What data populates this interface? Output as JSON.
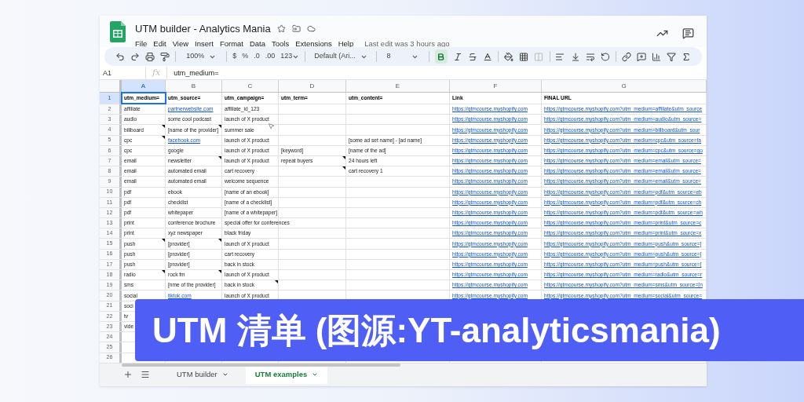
{
  "window": {
    "title": "UTM builder - Analytics Mania",
    "last_edit": "Last edit was 3 hours ago"
  },
  "menu": [
    "File",
    "Edit",
    "View",
    "Insert",
    "Format",
    "Data",
    "Tools",
    "Extensions",
    "Help"
  ],
  "toolbar": {
    "zoom": "100%",
    "currency": "$",
    "percent": "%",
    "decrease_decimals": ".0",
    "increase_decimals": ".00",
    "number_format": "123",
    "font": "Default (Ari...",
    "font_size": "8",
    "bold_on": true
  },
  "formula_bar": {
    "name_box": "A1",
    "fx": "fx",
    "formula": "utm_medium="
  },
  "columns": [
    {
      "label": "A",
      "selected": true
    },
    {
      "label": "B",
      "selected": false
    },
    {
      "label": "C",
      "selected": false
    },
    {
      "label": "D",
      "selected": false
    },
    {
      "label": "E",
      "selected": false
    },
    {
      "label": "F",
      "selected": false
    },
    {
      "label": "G",
      "selected": false
    }
  ],
  "rows": [
    {
      "number": "1",
      "kind": "header",
      "selected": true,
      "cells": [
        {
          "text": "utm_medium=",
          "link": false,
          "note": false
        },
        {
          "text": "utm_source=",
          "link": false,
          "note": false
        },
        {
          "text": "utm_campaign=",
          "link": false,
          "note": false
        },
        {
          "text": "utm_term=",
          "link": false,
          "note": false
        },
        {
          "text": "utm_content=",
          "link": false,
          "note": false
        },
        {
          "text": "Link",
          "link": false,
          "note": false
        },
        {
          "text": "FINAL URL",
          "link": false,
          "note": false
        }
      ]
    },
    {
      "number": "2",
      "kind": "data",
      "selected": false,
      "cells": [
        {
          "text": "affiliate",
          "link": false,
          "note": false
        },
        {
          "text": "partnerwebsite.com",
          "link": true,
          "note": false
        },
        {
          "text": "affiliate_id_123",
          "link": false,
          "note": false
        },
        {
          "note": false
        },
        {
          "note": false
        },
        {
          "text": "https://gtmcourse.myshopify.com",
          "link": true,
          "note": false
        },
        {
          "text": "https://gtmcourse.myshopify.com?utm_medium=affiliate&utm_source",
          "link": true,
          "note": false
        }
      ]
    },
    {
      "number": "3",
      "kind": "data",
      "selected": false,
      "cells": [
        {
          "text": "audio",
          "link": false,
          "note": false
        },
        {
          "text": "some cool podcast",
          "link": false,
          "note": false
        },
        {
          "text": "launch of X product",
          "link": false,
          "note": false
        },
        {
          "note": false
        },
        {
          "note": false
        },
        {
          "text": "https://gtmcourse.myshopify.com",
          "link": true,
          "note": false
        },
        {
          "text": "https://gtmcourse.myshopify.com?utm_medium=audio&utm_source=",
          "link": true,
          "note": false
        }
      ]
    },
    {
      "number": "4",
      "kind": "data",
      "selected": false,
      "cells": [
        {
          "text": "billboard",
          "link": false,
          "note": true
        },
        {
          "text": "[name of the provider]",
          "link": false,
          "note": true
        },
        {
          "text": "summer sale",
          "link": false,
          "note": false
        },
        {
          "note": false
        },
        {
          "note": false
        },
        {
          "text": "https://gtmcourse.myshopify.com",
          "link": true,
          "note": false
        },
        {
          "text": "https://gtmcourse.myshopify.com?utm_medium=billboard&utm_sour",
          "link": true,
          "note": false
        }
      ]
    },
    {
      "number": "5",
      "kind": "data",
      "selected": false,
      "cells": [
        {
          "text": "cpc",
          "link": false,
          "note": true
        },
        {
          "text": "facebook.com",
          "link": true,
          "note": false
        },
        {
          "text": "launch of X product",
          "link": false,
          "note": false
        },
        {
          "note": false
        },
        {
          "text": "[some ad set name] - [ad name]",
          "link": false,
          "note": false
        },
        {
          "text": "https://gtmcourse.myshopify.com",
          "link": true,
          "note": false
        },
        {
          "text": "https://gtmcourse.myshopify.com?utm_medium=cpc&utm_source=fa",
          "link": true,
          "note": false
        }
      ]
    },
    {
      "number": "6",
      "kind": "data",
      "selected": false,
      "cells": [
        {
          "text": "cpc",
          "link": false,
          "note": false
        },
        {
          "text": "google",
          "link": false,
          "note": false
        },
        {
          "text": "launch of X product",
          "link": false,
          "note": false
        },
        {
          "text": "[keyword]",
          "link": false,
          "note": false
        },
        {
          "text": "[name of the ad]",
          "link": false,
          "note": false
        },
        {
          "text": "https://gtmcourse.myshopify.com",
          "link": true,
          "note": false
        },
        {
          "text": "https://gtmcourse.myshopify.com?utm_medium=cpc&utm_source=go",
          "link": true,
          "note": false
        }
      ]
    },
    {
      "number": "7",
      "kind": "data",
      "selected": false,
      "cells": [
        {
          "text": "email",
          "link": false,
          "note": false
        },
        {
          "text": "newsletter",
          "link": false,
          "note": true
        },
        {
          "text": "launch of X product",
          "link": false,
          "note": false
        },
        {
          "text": "repeat buyers",
          "link": false,
          "note": true
        },
        {
          "text": "24 hours left",
          "link": false,
          "note": false
        },
        {
          "text": "https://gtmcourse.myshopify.com",
          "link": true,
          "note": false
        },
        {
          "text": "https://gtmcourse.myshopify.com?utm_medium=email&utm_source=",
          "link": true,
          "note": false
        }
      ]
    },
    {
      "number": "8",
      "kind": "data",
      "selected": false,
      "cells": [
        {
          "text": "email",
          "link": false,
          "note": false
        },
        {
          "text": "automated email",
          "link": false,
          "note": false
        },
        {
          "text": "cart recovery",
          "link": false,
          "note": false
        },
        {
          "note": true
        },
        {
          "text": "cart recovery 1",
          "link": false,
          "note": false
        },
        {
          "text": "https://gtmcourse.myshopify.com",
          "link": true,
          "note": false
        },
        {
          "text": "https://gtmcourse.myshopify.com?utm_medium=email&utm_source=",
          "link": true,
          "note": false
        }
      ]
    },
    {
      "number": "9",
      "kind": "data",
      "selected": false,
      "cells": [
        {
          "text": "email",
          "link": false,
          "note": false
        },
        {
          "text": "automated email",
          "link": false,
          "note": false
        },
        {
          "text": "welcome sequence",
          "link": false,
          "note": false
        },
        {
          "note": false
        },
        {
          "note": false
        },
        {
          "text": "https://gtmcourse.myshopify.com",
          "link": true,
          "note": false
        },
        {
          "text": "https://gtmcourse.myshopify.com?utm_medium=email&utm_source=",
          "link": true,
          "note": false
        }
      ]
    },
    {
      "number": "10",
      "kind": "data",
      "selected": false,
      "cells": [
        {
          "text": "pdf",
          "link": false,
          "note": false
        },
        {
          "text": "ebook",
          "link": false,
          "note": false
        },
        {
          "text": "[name of an ebook]",
          "link": false,
          "note": false
        },
        {
          "note": false
        },
        {
          "note": false
        },
        {
          "text": "https://gtmcourse.myshopify.com",
          "link": true,
          "note": false
        },
        {
          "text": "https://gtmcourse.myshopify.com?utm_medium=pdf&utm_source=eb",
          "link": true,
          "note": false
        }
      ]
    },
    {
      "number": "11",
      "kind": "data",
      "selected": false,
      "cells": [
        {
          "text": "pdf",
          "link": false,
          "note": false
        },
        {
          "text": "checklist",
          "link": false,
          "note": false
        },
        {
          "text": "[name of a checklist]",
          "link": false,
          "note": false
        },
        {
          "note": false
        },
        {
          "note": false
        },
        {
          "text": "https://gtmcourse.myshopify.com",
          "link": true,
          "note": false
        },
        {
          "text": "https://gtmcourse.myshopify.com?utm_medium=pdf&utm_source=ch",
          "link": true,
          "note": false
        }
      ]
    },
    {
      "number": "12",
      "kind": "data",
      "selected": false,
      "cells": [
        {
          "text": "pdf",
          "link": false,
          "note": false
        },
        {
          "text": "whitepaper",
          "link": false,
          "note": false
        },
        {
          "text": "[name of a whitepaper]",
          "link": false,
          "note": false
        },
        {
          "note": false
        },
        {
          "note": false
        },
        {
          "text": "https://gtmcourse.myshopify.com",
          "link": true,
          "note": false
        },
        {
          "text": "https://gtmcourse.myshopify.com?utm_medium=pdf&utm_source=wh",
          "link": true,
          "note": false
        }
      ]
    },
    {
      "number": "13",
      "kind": "data",
      "selected": false,
      "cells": [
        {
          "text": "print",
          "link": false,
          "note": false
        },
        {
          "text": "conference brochure",
          "link": false,
          "note": false
        },
        {
          "text": "special offer for conferences",
          "link": false,
          "note": false
        },
        {
          "note": false
        },
        {
          "note": false
        },
        {
          "text": "https://gtmcourse.myshopify.com",
          "link": true,
          "note": false
        },
        {
          "text": "https://gtmcourse.myshopify.com?utm_medium=print&utm_source=c",
          "link": true,
          "note": false
        }
      ]
    },
    {
      "number": "14",
      "kind": "data",
      "selected": false,
      "cells": [
        {
          "text": "print",
          "link": false,
          "note": false
        },
        {
          "text": "xyz newspaper",
          "link": false,
          "note": false
        },
        {
          "text": "black friday",
          "link": false,
          "note": false
        },
        {
          "note": false
        },
        {
          "note": false
        },
        {
          "text": "https://gtmcourse.myshopify.com",
          "link": true,
          "note": false
        },
        {
          "text": "https://gtmcourse.myshopify.com?utm_medium=print&utm_source=x",
          "link": true,
          "note": false
        }
      ]
    },
    {
      "number": "15",
      "kind": "data",
      "selected": false,
      "cells": [
        {
          "text": "push",
          "link": false,
          "note": true
        },
        {
          "text": "[provider]",
          "link": false,
          "note": true
        },
        {
          "text": "launch of X product",
          "link": false,
          "note": false
        },
        {
          "note": false
        },
        {
          "note": false
        },
        {
          "text": "https://gtmcourse.myshopify.com",
          "link": true,
          "note": false
        },
        {
          "text": "https://gtmcourse.myshopify.com?utm_medium=push&utm_source=[",
          "link": true,
          "note": false
        }
      ]
    },
    {
      "number": "16",
      "kind": "data",
      "selected": false,
      "cells": [
        {
          "text": "push",
          "link": false,
          "note": false
        },
        {
          "text": "[provider]",
          "link": false,
          "note": false
        },
        {
          "text": "cart recovery",
          "link": false,
          "note": false
        },
        {
          "note": false
        },
        {
          "note": false
        },
        {
          "text": "https://gtmcourse.myshopify.com",
          "link": true,
          "note": false
        },
        {
          "text": "https://gtmcourse.myshopify.com?utm_medium=push&utm_source=[",
          "link": true,
          "note": false
        }
      ]
    },
    {
      "number": "17",
      "kind": "data",
      "selected": false,
      "cells": [
        {
          "text": "push",
          "link": false,
          "note": false
        },
        {
          "text": "[provider]",
          "link": false,
          "note": false
        },
        {
          "text": "back in stock",
          "link": false,
          "note": false
        },
        {
          "note": false
        },
        {
          "note": false
        },
        {
          "text": "https://gtmcourse.myshopify.com",
          "link": true,
          "note": false
        },
        {
          "text": "https://gtmcourse.myshopify.com?utm_medium=push&utm_source=[",
          "link": true,
          "note": false
        }
      ]
    },
    {
      "number": "18",
      "kind": "data",
      "selected": false,
      "cells": [
        {
          "text": "radio",
          "link": false,
          "note": true
        },
        {
          "text": "rock fm",
          "link": false,
          "note": true
        },
        {
          "text": "launch of X product",
          "link": false,
          "note": false
        },
        {
          "note": false
        },
        {
          "note": false
        },
        {
          "text": "https://gtmcourse.myshopify.com",
          "link": true,
          "note": false
        },
        {
          "text": "https://gtmcourse.myshopify.com?utm_medium=radio&utm_source=r",
          "link": true,
          "note": false
        }
      ]
    },
    {
      "number": "19",
      "kind": "data",
      "selected": false,
      "cells": [
        {
          "text": "sms",
          "link": false,
          "note": false
        },
        {
          "text": "[nme of the provider]",
          "link": false,
          "note": false
        },
        {
          "text": "back in stock",
          "link": false,
          "note": true
        },
        {
          "note": false
        },
        {
          "note": false
        },
        {
          "text": "https://gtmcourse.myshopify.com",
          "link": true,
          "note": false
        },
        {
          "text": "https://gtmcourse.myshopify.com?utm_medium=sms&utm_source=[n",
          "link": true,
          "note": false
        }
      ]
    },
    {
      "number": "20",
      "kind": "data",
      "selected": false,
      "cells": [
        {
          "text": "social",
          "link": false,
          "note": false
        },
        {
          "text": "tiktok.com",
          "link": true,
          "note": false
        },
        {
          "text": "launch of X product",
          "link": false,
          "note": false
        },
        {
          "note": false
        },
        {
          "note": false
        },
        {
          "text": "https://gtmcourse.myshopify.com",
          "link": true,
          "note": false
        },
        {
          "text": "https://gtmcourse.myshopify.com?utm_medium=social&utm_source=",
          "link": true,
          "note": false
        }
      ]
    },
    {
      "number": "21",
      "kind": "data",
      "selected": false,
      "cells": [
        {
          "text": "soci",
          "link": false
        }
      ]
    },
    {
      "number": "22",
      "kind": "data",
      "selected": false,
      "cells": [
        {
          "text": "tv",
          "link": false
        }
      ]
    },
    {
      "number": "23",
      "kind": "data",
      "selected": false,
      "cells": [
        {
          "text": "vide",
          "link": false
        }
      ]
    },
    {
      "number": "24",
      "kind": "data",
      "selected": false,
      "cells": []
    },
    {
      "number": "25",
      "kind": "data",
      "selected": false,
      "cells": []
    },
    {
      "number": "26",
      "kind": "data",
      "selected": false,
      "cells": []
    }
  ],
  "sheet_tabs": [
    {
      "label": "UTM builder",
      "selected": false
    },
    {
      "label": "UTM examples",
      "selected": true
    }
  ],
  "banner": {
    "text": "UTM 清单 (图源:YT-analyticsmania)"
  }
}
